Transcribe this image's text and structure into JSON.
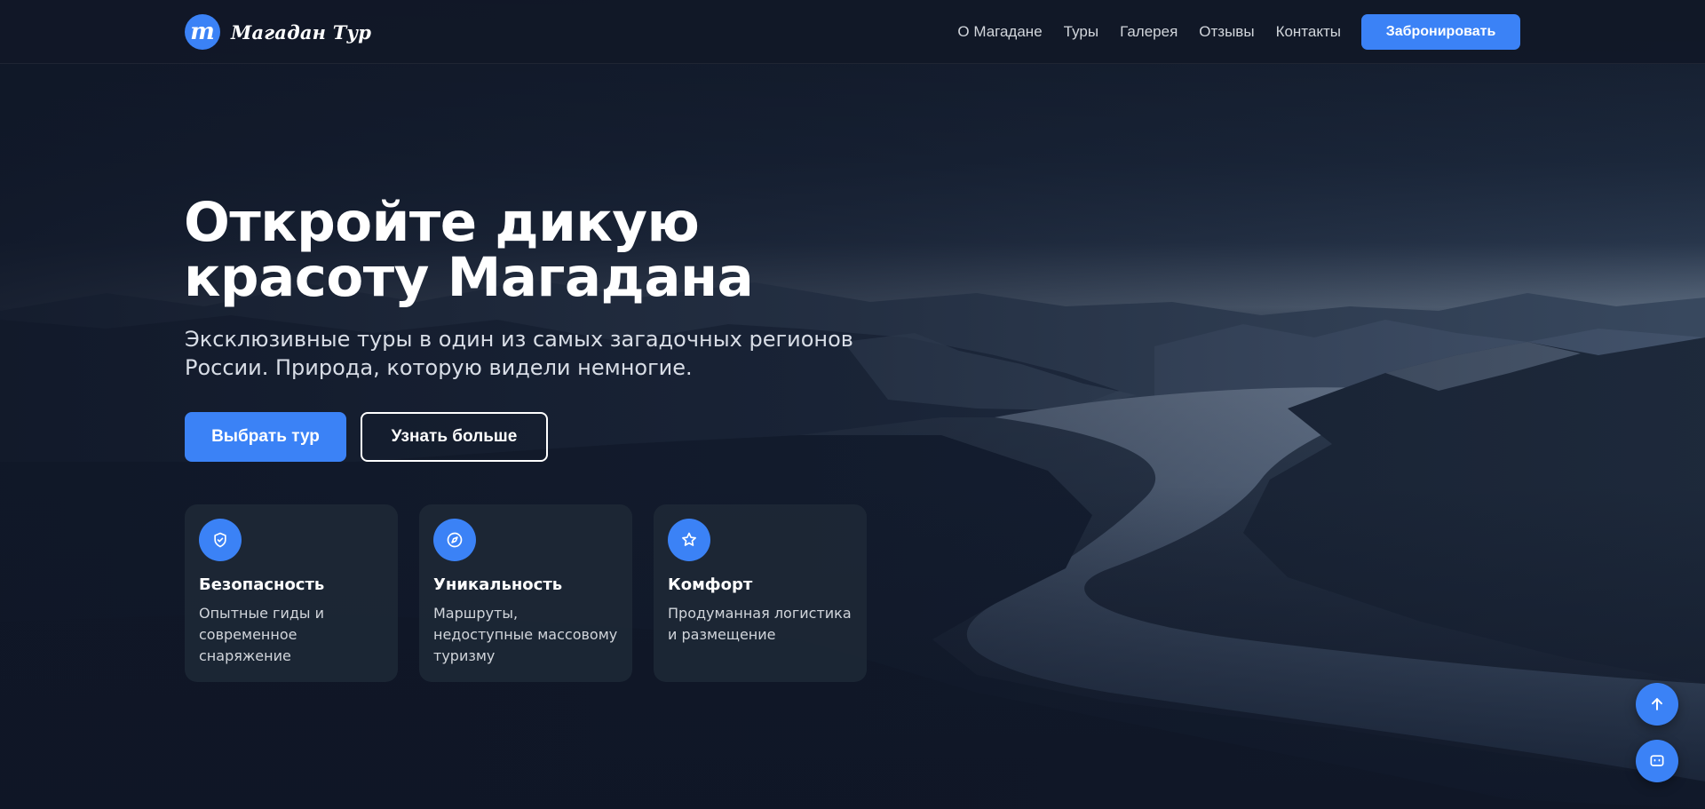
{
  "brand": {
    "logo_letter": "m",
    "name": "Магадан Тур"
  },
  "nav": {
    "items": [
      "О Магадане",
      "Туры",
      "Галерея",
      "Отзывы",
      "Контакты"
    ],
    "cta_label": "Забронировать"
  },
  "hero": {
    "title_line1": "Откройте дикую",
    "title_line2": "красоту Магадана",
    "subtitle_line1": "Эксклюзивные туры в один из самых загадочных регионов",
    "subtitle_line2": "России. Природа, которую видели немногие.",
    "primary_button": "Выбрать тур",
    "secondary_button": "Узнать больше"
  },
  "features": [
    {
      "icon": "shield-check-icon",
      "title": "Безопасность",
      "text": "Опытные гиды и современное снаряжение"
    },
    {
      "icon": "compass-icon",
      "title": "Уникальность",
      "text": "Маршруты, недоступные массовому туризму"
    },
    {
      "icon": "star-icon",
      "title": "Комфорт",
      "text": "Продуманная логистика и размещение"
    }
  ],
  "floating": {
    "scroll_top_icon": "arrow-up-icon",
    "chat_icon": "chat-icon"
  },
  "colors": {
    "accent": "#3b82f6",
    "header_bg": "#111827",
    "card_bg": "#1f2937"
  }
}
